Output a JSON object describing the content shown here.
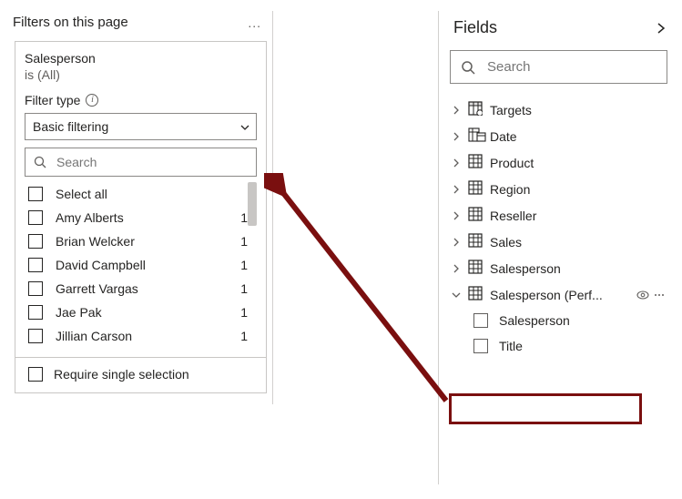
{
  "filters": {
    "header": "Filters on this page",
    "card": {
      "field_name": "Salesperson",
      "status": "is (All)",
      "filter_type_label": "Filter type",
      "filter_type_value": "Basic filtering",
      "search_placeholder": "Search",
      "values": [
        {
          "label": "Select all",
          "count": ""
        },
        {
          "label": "Amy Alberts",
          "count": "1"
        },
        {
          "label": "Brian Welcker",
          "count": "1"
        },
        {
          "label": "David Campbell",
          "count": "1"
        },
        {
          "label": "Garrett Vargas",
          "count": "1"
        },
        {
          "label": "Jae Pak",
          "count": "1"
        },
        {
          "label": "Jillian Carson",
          "count": "1"
        }
      ],
      "require_single_label": "Require single selection"
    }
  },
  "fields": {
    "header": "Fields",
    "search_placeholder": "Search",
    "tables": [
      {
        "name": "Targets",
        "icon": "calc-table",
        "expanded": false
      },
      {
        "name": "Date",
        "icon": "date-table",
        "expanded": false
      },
      {
        "name": "Product",
        "icon": "table",
        "expanded": false
      },
      {
        "name": "Region",
        "icon": "table",
        "expanded": false
      },
      {
        "name": "Reseller",
        "icon": "table",
        "expanded": false
      },
      {
        "name": "Sales",
        "icon": "table",
        "expanded": false
      },
      {
        "name": "Salesperson",
        "icon": "table",
        "expanded": false
      },
      {
        "name": "Salesperson (Perf...",
        "icon": "table",
        "expanded": true,
        "fields": [
          {
            "name": "Salesperson",
            "highlighted": true
          },
          {
            "name": "Title",
            "highlighted": false
          }
        ]
      }
    ]
  }
}
